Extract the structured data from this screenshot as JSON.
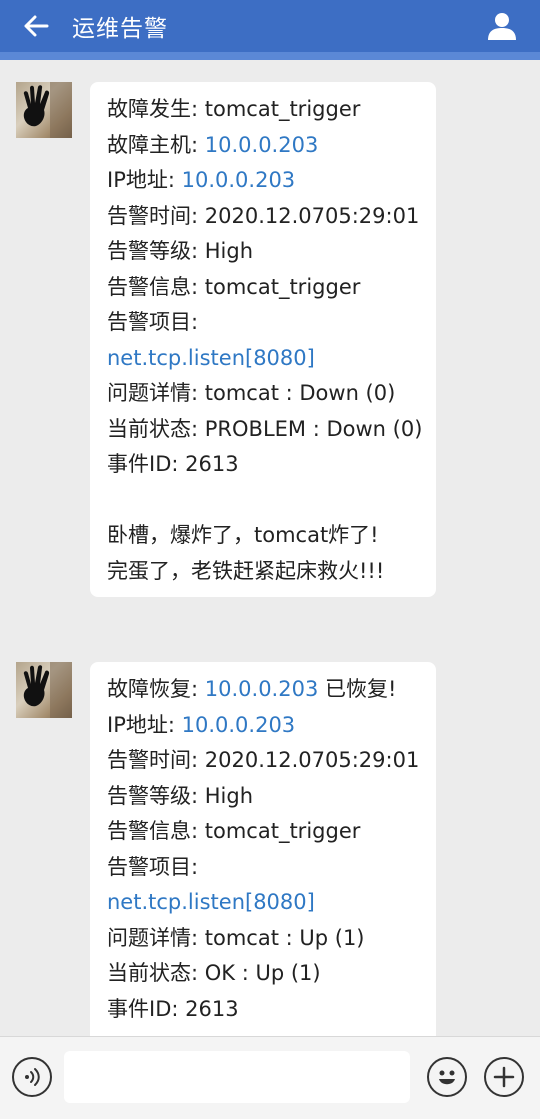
{
  "header": {
    "title": "运维告警",
    "back_icon": "arrow-left-icon",
    "user_icon": "user-icon"
  },
  "messages": [
    {
      "lines": [
        {
          "label": "故障发生: ",
          "value": "tomcat_trigger",
          "link": false
        },
        {
          "label": "故障主机: ",
          "value": "10.0.0.203",
          "link": true
        },
        {
          "label": "IP地址: ",
          "value": "10.0.0.203",
          "link": true
        },
        {
          "label": "告警时间: ",
          "value": "2020.12.0705:29:01",
          "link": false
        },
        {
          "label": "告警等级: ",
          "value": "High",
          "link": false
        },
        {
          "label": "告警信息: ",
          "value": "tomcat_trigger",
          "link": false
        }
      ],
      "item_label": "告警项目:",
      "item_link": "net.tcp.listen[8080]",
      "detail_label": "问题详情: ",
      "detail_value": "tomcat : Down (0)",
      "status_label": "当前状态: ",
      "status_value": "PROBLEM : Down (0)",
      "event_label": "事件ID: ",
      "event_value": "2613",
      "note_line1": "卧槽，爆炸了，tomcat炸了!",
      "note_line2": "完蛋了，老铁赶紧起床救火!!!"
    },
    {
      "recover_label": "故障恢复: ",
      "recover_ip": "10.0.0.203",
      "recover_suffix": " 已恢复!",
      "lines": [
        {
          "label": "IP地址: ",
          "value": "10.0.0.203",
          "link": true
        },
        {
          "label": "告警时间: ",
          "value": "2020.12.0705:29:01",
          "link": false
        },
        {
          "label": "告警等级: ",
          "value": "High",
          "link": false
        },
        {
          "label": "告警信息: ",
          "value": "tomcat_trigger",
          "link": false
        }
      ],
      "item_label": "告警项目:",
      "item_link": "net.tcp.listen[8080]",
      "detail_label": "问题详情: ",
      "detail_value": "tomcat : Up (1)",
      "status_label": "当前状态: ",
      "status_value": "OK : Up (1)",
      "event_label": "事件ID: ",
      "event_value": "2613"
    }
  ],
  "input": {
    "placeholder": "",
    "voice_icon": "voice-icon",
    "emoji_icon": "emoji-icon",
    "plus_icon": "plus-icon"
  },
  "colors": {
    "header": "#3d6ec4",
    "link": "#2f78c4",
    "background": "#ececec"
  }
}
